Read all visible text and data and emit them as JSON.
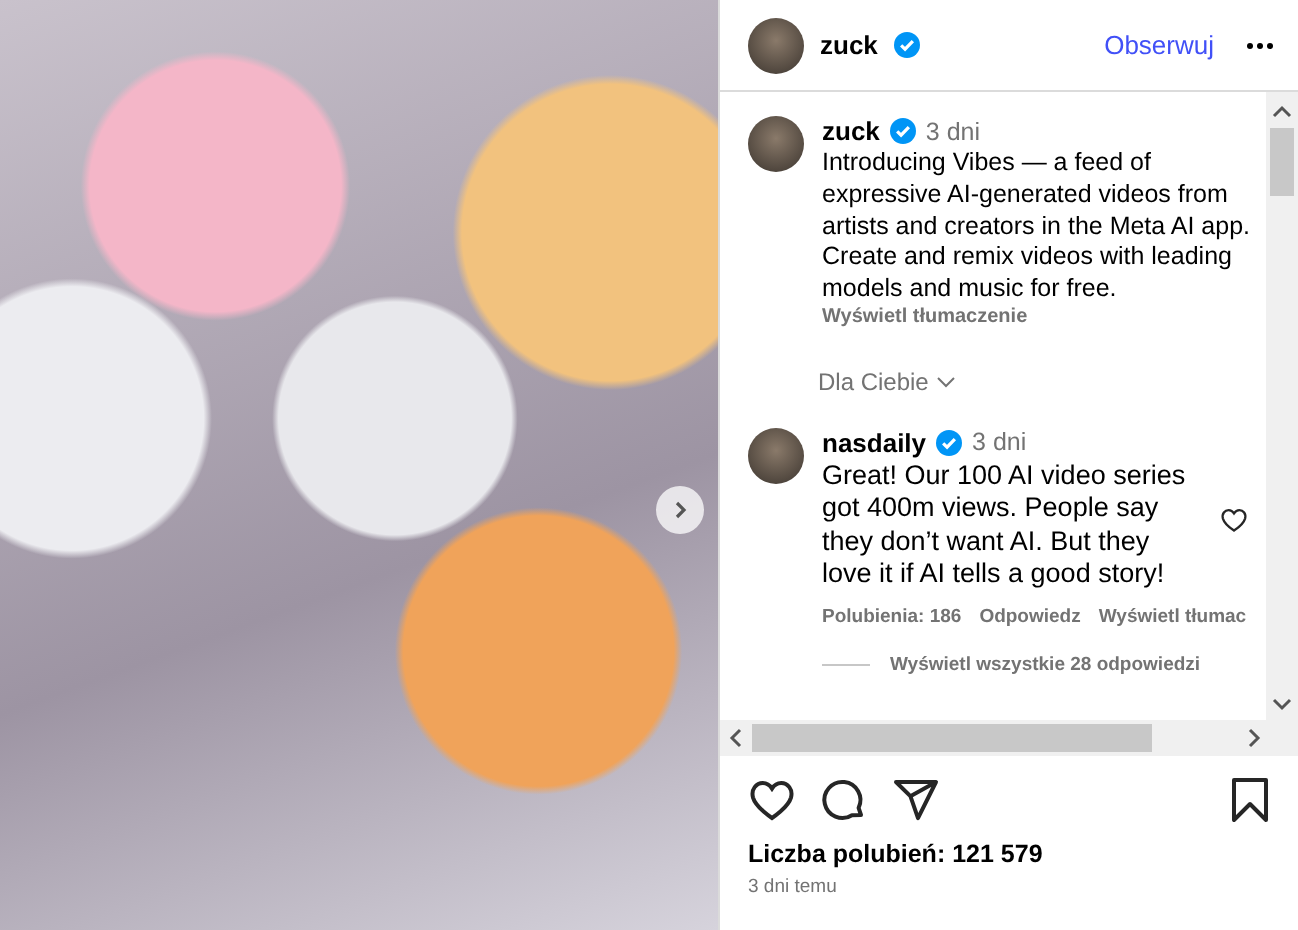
{
  "post_header": {
    "username": "zuck",
    "verified": true,
    "follow": "Obserwuj"
  },
  "caption": {
    "username": "zuck",
    "verified": true,
    "time": "3 dni",
    "text": "Introducing Vibes — a feed of expressive AI-generated videos from artists and creators in the Meta AI app. Create and remix videos with leading models and music for free.",
    "translate": "Wyświetl tłumaczenie"
  },
  "sort": {
    "label": "Dla Ciebie"
  },
  "comments": [
    {
      "username": "nasdaily",
      "verified": true,
      "time": "3 dni",
      "text": "Great! Our 100 AI video series got 400m views. People say they don’t want AI. But they love it if AI tells a good story!",
      "liked": false,
      "likes": "Polubienia: 186",
      "reply": "Odpowiedz",
      "translate": "Wyświetl tłumac",
      "view_replies": "Wyświetl wszystkie 28 odpowiedzi"
    }
  ],
  "likes_count": "Liczba polubień: 121 579",
  "date": "3 dni temu"
}
